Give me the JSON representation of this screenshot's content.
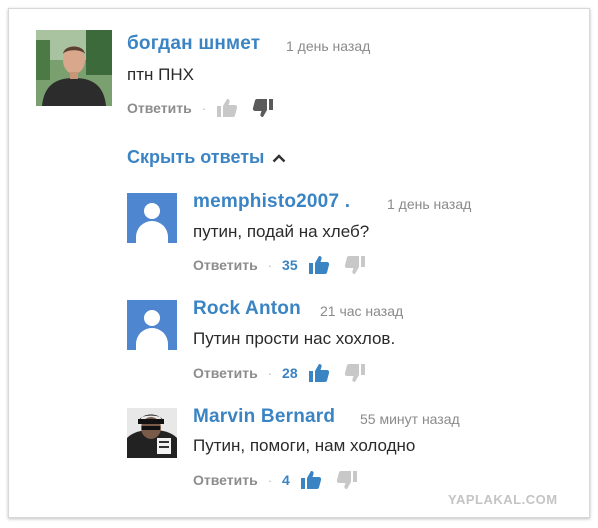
{
  "colors": {
    "link_blue": "#3b84c4",
    "avatar_blue": "#4f86d0",
    "muted_gray": "#8c8c8c"
  },
  "comments": [
    {
      "author": "богдан шнмет",
      "time": "1 день назад",
      "text": "птн ПНХ",
      "reply_label": "Ответить",
      "likes": "",
      "avatar": "photo-man"
    },
    {
      "author": "memphisto2007 .",
      "time": "1 день назад",
      "text": "путин, подай на хлеб?",
      "reply_label": "Ответить",
      "likes": "35",
      "avatar": "default-user-icon"
    },
    {
      "author": "Rock Anton",
      "time": "21 час назад",
      "text": "Путин прости нас хохлов.",
      "reply_label": "Ответить",
      "likes": "28",
      "avatar": "default-user-icon"
    },
    {
      "author": "Marvin Bernard",
      "time": "55 минут назад",
      "text": "Путин, помоги, нам холодно",
      "reply_label": "Ответить",
      "likes": "4",
      "avatar": "photo-bw"
    }
  ],
  "hide_replies_label": "Скрыть ответы",
  "watermark": "YAPLAKAL.COM"
}
